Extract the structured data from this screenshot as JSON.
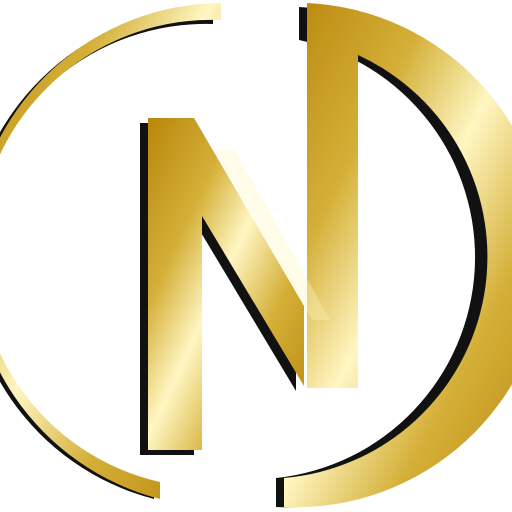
{
  "logo": {
    "letter": "N",
    "icon": "gold-n-monogram-circle-icon"
  },
  "colors": {
    "background": "#ffffff",
    "gold_dark": "#b8860b",
    "gold_mid": "#d4af37",
    "gold_light": "#fbeaa3",
    "gold_highlight": "#fff6c2",
    "shadow": "#111111"
  }
}
